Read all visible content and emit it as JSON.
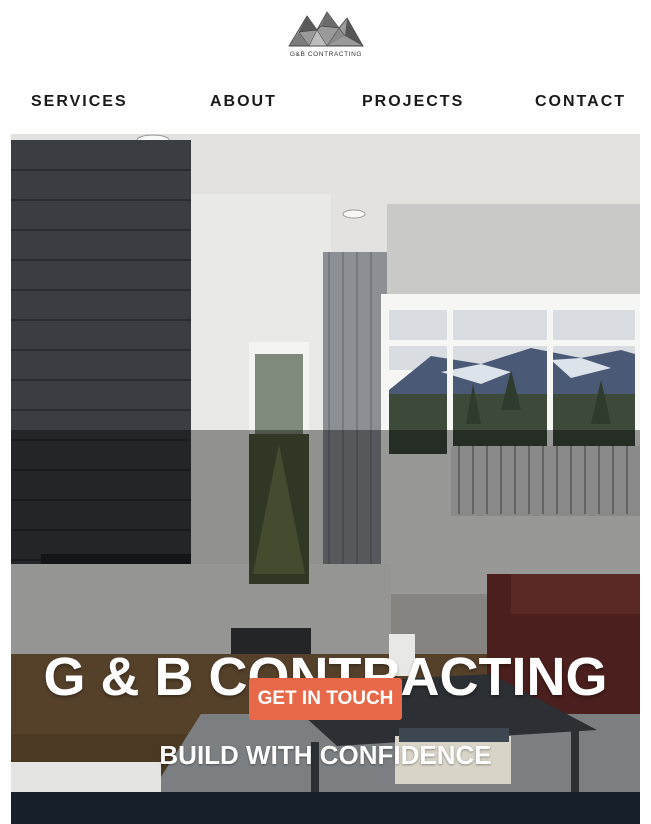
{
  "brand": {
    "logo_text": "G&B CONTRACTING",
    "logo_icon": "geodesic-mountain-icon"
  },
  "nav": {
    "items": [
      {
        "label": "SERVICES"
      },
      {
        "label": "ABOUT"
      },
      {
        "label": "PROJECTS"
      },
      {
        "label": "CONTACT"
      }
    ]
  },
  "hero": {
    "title": "G & B CONTRACTING",
    "subtitle": "BUILD WITH CONFIDENCE",
    "cta_label": "GET IN TOUCH",
    "cta_color": "#e8694a",
    "image": "living-room-with-fireplace-and-mountain-view"
  },
  "colors": {
    "nav_text": "#1a1a1a",
    "footer_band": "#17202a"
  }
}
